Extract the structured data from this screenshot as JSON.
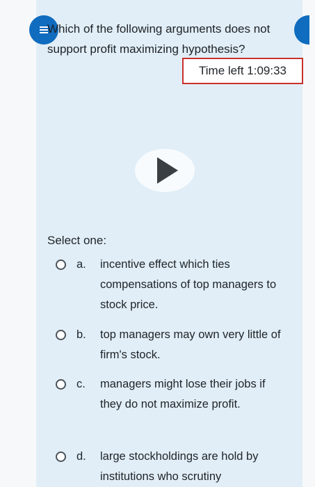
{
  "question": {
    "text": "Which of the following arguments does not support profit maximizing hypothesis?",
    "timer_label": "Time left 1:09:33"
  },
  "answer_prompt": "Select one:",
  "options": [
    {
      "letter": "a.",
      "text": "incentive effect which ties compensations of top managers to stock price."
    },
    {
      "letter": "b.",
      "text": "top managers may own very little of firm's stock."
    },
    {
      "letter": "c.",
      "text": "managers might lose their jobs if they do not maximize profit."
    },
    {
      "letter": "d.",
      "text": "large stockholdings are hold by institutions who scrutiny"
    }
  ],
  "icons": {
    "menu": "hamburger-menu-icon",
    "play": "play-icon",
    "radio": "radio-button-icon"
  },
  "colors": {
    "card_background": "#e1eef7",
    "accent": "#0f6cbf",
    "timer_border": "#c9302c"
  }
}
